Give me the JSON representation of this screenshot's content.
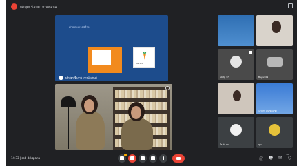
{
  "meeting": {
    "top_title": "หลักสูตร ชีวภาพ - ค่าประมาณ",
    "bottom_info": "14:33 | ssd-dskq-anu",
    "participant_count": "32"
  },
  "presentation": {
    "slide_text": "ตัวอย่างการสร้าง",
    "carrot_label": "แครอท",
    "presenter_name": "หลักสูตร ชีวภาพ (การนำเสนอ)"
  },
  "participants": [
    {
      "label": ""
    },
    {
      "label": ""
    },
    {
      "label": "alistp 37"
    },
    {
      "label": "Bayon 09"
    },
    {
      "label": ""
    },
    {
      "label": "ไกรจักร์ คนเขตเดชา"
    },
    {
      "label": "จีร ทำ คน"
    },
    {
      "label": "คุณ"
    }
  ],
  "colors": {
    "background": "#202124",
    "end_call": "#ea4335",
    "presentation_bg": "#1d4c8c",
    "slide_accent": "#f28a1e"
  }
}
